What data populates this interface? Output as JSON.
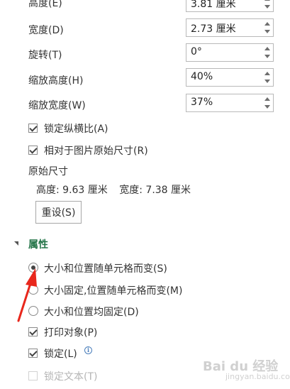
{
  "size": {
    "height_label": "高度(E)",
    "height_value": "3.81 厘米",
    "width_label": "宽度(D)",
    "width_value": "2.73 厘米",
    "rotation_label": "旋转(T)",
    "rotation_value": "0°",
    "scale_height_label": "缩放高度(H)",
    "scale_height_value": "40%",
    "scale_width_label": "缩放宽度(W)",
    "scale_width_value": "37%",
    "lock_aspect_label": "锁定纵横比(A)",
    "lock_aspect_checked": true,
    "relative_original_label": "相对于图片原始尺寸(R)",
    "relative_original_checked": true,
    "original_size_title": "原始尺寸",
    "original_height_label": "高度:",
    "original_height_value": "9.63 厘米",
    "original_width_label": "宽度:",
    "original_width_value": "7.38 厘米",
    "reset_label": "重设(S)"
  },
  "properties": {
    "title": "属性",
    "radio_move_and_size": "大小和位置随单元格而变(S)",
    "radio_move_no_size": "大小固定,位置随单元格而变(M)",
    "radio_fixed": "大小和位置均固定(D)",
    "selected_option": "move_and_size",
    "print_object_label": "打印对象(P)",
    "print_object_checked": true,
    "locked_label": "锁定(L)",
    "locked_checked": true,
    "lock_text_label": "锁定文本(T)",
    "lock_text_checked": false,
    "lock_text_enabled": false
  },
  "watermark": {
    "text": "Bai du 经验",
    "sub": "jingyan.baidu.com"
  },
  "colors": {
    "section_title": "#217346",
    "annotation_arrow": "#e8271c"
  },
  "icons": {
    "info": "info-icon",
    "collapse": "caret-down-icon"
  }
}
